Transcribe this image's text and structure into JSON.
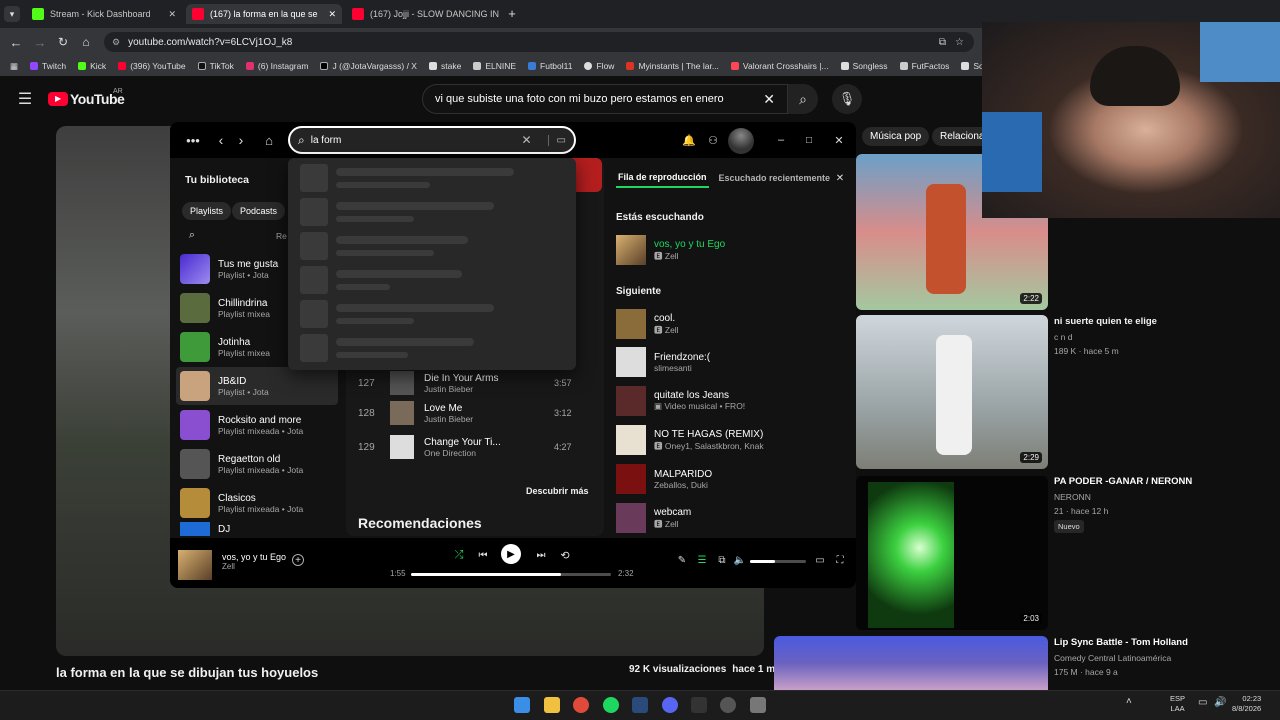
{
  "browser": {
    "tabs": [
      {
        "label": "Stream - Kick Dashboard",
        "color": "#53fc18"
      },
      {
        "label": "(167) la forma en la que se",
        "color": "#ff0033"
      },
      {
        "label": "(167) Jojji - SLOW DANCING IN",
        "color": "#ff0033"
      }
    ],
    "url": "youtube.com/watch?v=6LCVj1OJ_k8",
    "bookmarks": [
      "Twitch",
      "Kick",
      "(396) YouTube",
      "TikTok",
      "(6) Instagram",
      "J (@JotaVargasss) / X",
      "stake",
      "ELNINE",
      "Futbol11",
      "Flow",
      "Myinstants | The lar...",
      "Valorant Crosshairs |...",
      "Songless",
      "FutFactos",
      "Solicitu"
    ]
  },
  "youtube": {
    "logo": "YouTube",
    "region": "AR",
    "search_value": "vi que subiste una foto con mi buzo pero estamos en enero",
    "chips": [
      "Música pop",
      "Relaciona"
    ],
    "video_title": "la forma en la que se dibujan tus hoyuelos",
    "views": "92 K visualizaciones",
    "age": "hace 1 m",
    "side_videos": [
      {
        "duration": "2:22",
        "title": "",
        "channel": "",
        "meta": ""
      },
      {
        "duration": "2:29",
        "title": "ni suerte quien te elige",
        "channel": "c n d",
        "meta": "189 K · hace 5 m"
      },
      {
        "duration": "2:03",
        "title": "PA PODER -GANAR / NERONN",
        "channel": "NERONN",
        "meta": "21 · hace 12 h",
        "badge": "Nuevo"
      },
      {
        "duration": "",
        "title": "Lip Sync Battle - Tom Holland",
        "channel": "Comedy Central Latinoamérica",
        "meta": "175 M · hace 9 a"
      }
    ]
  },
  "spotify": {
    "search_value": "la form",
    "library_title": "Tu biblioteca",
    "filters": [
      "Playlists",
      "Podcasts"
    ],
    "recents_label": "Re",
    "library": [
      {
        "name": "Tus me gusta",
        "sub": "Playlist • Jota",
        "color": "#6b4de6"
      },
      {
        "name": "Chillindrina",
        "sub": "Playlist mixea",
        "color": "#5a6b3d"
      },
      {
        "name": "Jotinha",
        "sub": "Playlist mixea",
        "color": "#3f9a3a"
      },
      {
        "name": "JB&ID",
        "sub": "Playlist • Jota",
        "color": "#c9a27e"
      },
      {
        "name": "Rocksito and more",
        "sub": "Playlist mixeada • Jota",
        "color": "#8a4fd0"
      },
      {
        "name": "Regaetton old",
        "sub": "Playlist mixeada • Jota",
        "color": "#555"
      },
      {
        "name": "Clasicos",
        "sub": "Playlist mixeada • Jota",
        "color": "#b58c3a"
      },
      {
        "name": "DJ",
        "sub": "",
        "color": "#1e6bd6"
      }
    ],
    "tracks": [
      {
        "num": "127",
        "title": "Die In Your Arms",
        "artist": "Justin Bieber",
        "dur": "3:57"
      },
      {
        "num": "128",
        "title": "Love Me",
        "artist": "Justin Bieber",
        "dur": "3:12"
      },
      {
        "num": "129",
        "title": "Change Your Ti...",
        "artist": "One Direction",
        "dur": "4:27"
      }
    ],
    "discover": "Descubrir más",
    "recommendations": "Recomendaciones",
    "queue_tab": "Fila de reproducción",
    "recent_tab": "Escuchado recientemente",
    "now_label": "Estás escuchando",
    "now": {
      "title": "vos, yo y tu Ego",
      "artist": "Zell"
    },
    "next_label": "Siguiente",
    "queue": [
      {
        "title": "cool.",
        "artist": "Zell",
        "color": "#8a6b3a"
      },
      {
        "title": "Friendzone:(",
        "artist": "slimesanti",
        "color": "#ddd"
      },
      {
        "title": "quitate los Jeans",
        "artist": "Video musical • FRO!",
        "color": "#5a2a2a"
      },
      {
        "title": "NO TE HAGAS (REMIX)",
        "artist": "Oney1, Salastkbron, Knak",
        "color": "#e8e0d0"
      },
      {
        "title": "MALPARIDO",
        "artist": "Zeballos, Duki",
        "color": "#7a1010"
      },
      {
        "title": "webcam",
        "artist": "Zell",
        "color": "#6a3a5a"
      }
    ],
    "player": {
      "title": "vos, yo y tu Ego",
      "artist": "Zell",
      "elapsed": "1:55",
      "total": "2:32",
      "progress": 0.75,
      "volume": 0.45
    }
  },
  "taskbar": {
    "lang": "ESP",
    "lang2": "LAA",
    "time": "02:23",
    "date": "8/8/2026"
  }
}
